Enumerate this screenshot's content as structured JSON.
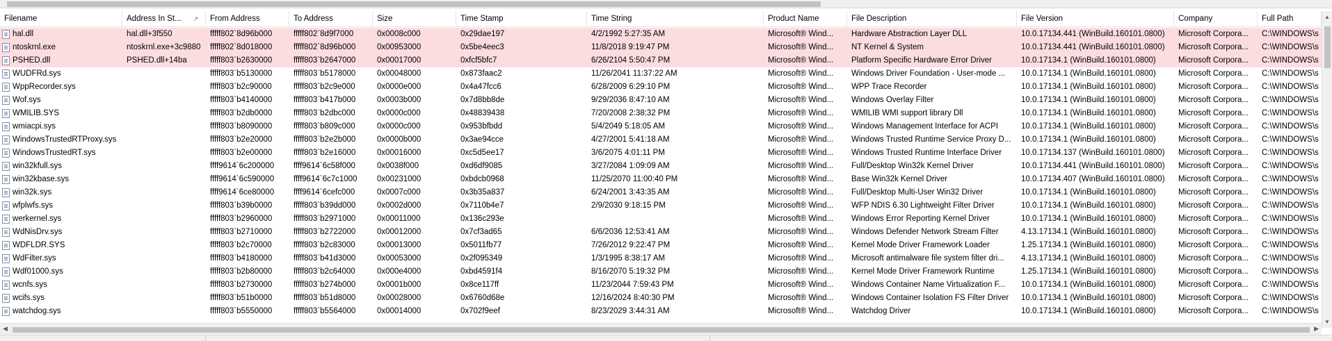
{
  "columns": [
    {
      "key": "filename",
      "label": "Filename"
    },
    {
      "key": "address_in_stack",
      "label": "Address In St..."
    },
    {
      "key": "from_address",
      "label": "From Address"
    },
    {
      "key": "to_address",
      "label": "To Address"
    },
    {
      "key": "size",
      "label": "Size"
    },
    {
      "key": "time_stamp",
      "label": "Time Stamp"
    },
    {
      "key": "time_string",
      "label": "Time String"
    },
    {
      "key": "product_name",
      "label": "Product Name"
    },
    {
      "key": "file_description",
      "label": "File Description"
    },
    {
      "key": "file_version",
      "label": "File Version"
    },
    {
      "key": "company",
      "label": "Company"
    },
    {
      "key": "full_path",
      "label": "Full Path"
    }
  ],
  "sort_indicator": "↗",
  "highlight_color": "#fbdde0",
  "rows": [
    {
      "highlight": true,
      "filename": "hal.dll",
      "address_in_stack": "hal.dll+3f550",
      "from_address": "fffff802`8d96b000",
      "to_address": "fffff802`8d9f7000",
      "size": "0x0008c000",
      "time_stamp": "0x29dae197",
      "time_string": "4/2/1992 5:27:35 AM",
      "product_name": "Microsoft® Wind...",
      "file_description": "Hardware Abstraction Layer DLL",
      "file_version": "10.0.17134.441 (WinBuild.160101.0800)",
      "company": "Microsoft Corpora...",
      "full_path": "C:\\WINDOWS\\s"
    },
    {
      "highlight": true,
      "filename": "ntoskrnl.exe",
      "address_in_stack": "ntoskrnl.exe+3c9880",
      "from_address": "fffff802`8d018000",
      "to_address": "fffff802`8d96b000",
      "size": "0x00953000",
      "time_stamp": "0x5be4eec3",
      "time_string": "11/8/2018 9:19:47 PM",
      "product_name": "Microsoft® Wind...",
      "file_description": "NT Kernel & System",
      "file_version": "10.0.17134.441 (WinBuild.160101.0800)",
      "company": "Microsoft Corpora...",
      "full_path": "C:\\WINDOWS\\s"
    },
    {
      "highlight": true,
      "filename": "PSHED.dll",
      "address_in_stack": "PSHED.dll+14ba",
      "from_address": "fffff803`b2630000",
      "to_address": "fffff803`b2647000",
      "size": "0x00017000",
      "time_stamp": "0xfcf5bfc7",
      "time_string": "6/26/2104 5:50:47 PM",
      "product_name": "Microsoft® Wind...",
      "file_description": "Platform Specific Hardware Error Driver",
      "file_version": "10.0.17134.1 (WinBuild.160101.0800)",
      "company": "Microsoft Corpora...",
      "full_path": "C:\\WINDOWS\\s"
    },
    {
      "highlight": false,
      "filename": "WUDFRd.sys",
      "address_in_stack": "",
      "from_address": "fffff803`b5130000",
      "to_address": "fffff803`b5178000",
      "size": "0x00048000",
      "time_stamp": "0x873faac2",
      "time_string": "11/26/2041 11:37:22 AM",
      "product_name": "Microsoft® Wind...",
      "file_description": "Windows Driver Foundation - User-mode ...",
      "file_version": "10.0.17134.1 (WinBuild.160101.0800)",
      "company": "Microsoft Corpora...",
      "full_path": "C:\\WINDOWS\\s"
    },
    {
      "highlight": false,
      "filename": "WppRecorder.sys",
      "address_in_stack": "",
      "from_address": "fffff803`b2c90000",
      "to_address": "fffff803`b2c9e000",
      "size": "0x0000e000",
      "time_stamp": "0x4a47fcc6",
      "time_string": "6/28/2009 6:29:10 PM",
      "product_name": "Microsoft® Wind...",
      "file_description": "WPP Trace Recorder",
      "file_version": "10.0.17134.1 (WinBuild.160101.0800)",
      "company": "Microsoft Corpora...",
      "full_path": "C:\\WINDOWS\\s"
    },
    {
      "highlight": false,
      "filename": "Wof.sys",
      "address_in_stack": "",
      "from_address": "fffff803`b4140000",
      "to_address": "fffff803`b417b000",
      "size": "0x0003b000",
      "time_stamp": "0x7d8bb8de",
      "time_string": "9/29/2036 8:47:10 AM",
      "product_name": "Microsoft® Wind...",
      "file_description": "Windows Overlay Filter",
      "file_version": "10.0.17134.1 (WinBuild.160101.0800)",
      "company": "Microsoft Corpora...",
      "full_path": "C:\\WINDOWS\\s"
    },
    {
      "highlight": false,
      "filename": "WMILIB.SYS",
      "address_in_stack": "",
      "from_address": "fffff803`b2db0000",
      "to_address": "fffff803`b2dbc000",
      "size": "0x0000c000",
      "time_stamp": "0x48839438",
      "time_string": "7/20/2008 2:38:32 PM",
      "product_name": "Microsoft® Wind...",
      "file_description": "WMILIB WMI support library Dll",
      "file_version": "10.0.17134.1 (WinBuild.160101.0800)",
      "company": "Microsoft Corpora...",
      "full_path": "C:\\WINDOWS\\s"
    },
    {
      "highlight": false,
      "filename": "wmiacpi.sys",
      "address_in_stack": "",
      "from_address": "fffff803`b8090000",
      "to_address": "fffff803`b809c000",
      "size": "0x0000c000",
      "time_stamp": "0x953bfbdd",
      "time_string": "5/4/2049 5:18:05 AM",
      "product_name": "Microsoft® Wind...",
      "file_description": "Windows Management Interface for ACPI",
      "file_version": "10.0.17134.1 (WinBuild.160101.0800)",
      "company": "Microsoft Corpora...",
      "full_path": "C:\\WINDOWS\\s"
    },
    {
      "highlight": false,
      "filename": "WindowsTrustedRTProxy.sys",
      "address_in_stack": "",
      "from_address": "fffff803`b2e20000",
      "to_address": "fffff803`b2e2b000",
      "size": "0x0000b000",
      "time_stamp": "0x3ae94cce",
      "time_string": "4/27/2001 5:41:18 AM",
      "product_name": "Microsoft® Wind...",
      "file_description": "Windows Trusted Runtime Service Proxy D...",
      "file_version": "10.0.17134.1 (WinBuild.160101.0800)",
      "company": "Microsoft Corpora...",
      "full_path": "C:\\WINDOWS\\s"
    },
    {
      "highlight": false,
      "filename": "WindowsTrustedRT.sys",
      "address_in_stack": "",
      "from_address": "fffff803`b2e00000",
      "to_address": "fffff803`b2e16000",
      "size": "0x00016000",
      "time_stamp": "0xc5d5ee17",
      "time_string": "3/6/2075 4:01:11 PM",
      "product_name": "Microsoft® Wind...",
      "file_description": "Windows Trusted Runtime Interface Driver",
      "file_version": "10.0.17134.137 (WinBuild.160101.0800)",
      "company": "Microsoft Corpora...",
      "full_path": "C:\\WINDOWS\\s"
    },
    {
      "highlight": false,
      "filename": "win32kfull.sys",
      "address_in_stack": "",
      "from_address": "ffff9614`6c200000",
      "to_address": "ffff9614`6c58f000",
      "size": "0x0038f000",
      "time_stamp": "0xd6df9085",
      "time_string": "3/27/2084 1:09:09 AM",
      "product_name": "Microsoft® Wind...",
      "file_description": "Full/Desktop Win32k Kernel Driver",
      "file_version": "10.0.17134.441 (WinBuild.160101.0800)",
      "company": "Microsoft Corpora...",
      "full_path": "C:\\WINDOWS\\s"
    },
    {
      "highlight": false,
      "filename": "win32kbase.sys",
      "address_in_stack": "",
      "from_address": "ffff9614`6c590000",
      "to_address": "ffff9614`6c7c1000",
      "size": "0x00231000",
      "time_stamp": "0xbdcb0968",
      "time_string": "11/25/2070 11:00:40 PM",
      "product_name": "Microsoft® Wind...",
      "file_description": "Base Win32k Kernel Driver",
      "file_version": "10.0.17134.407 (WinBuild.160101.0800)",
      "company": "Microsoft Corpora...",
      "full_path": "C:\\WINDOWS\\s"
    },
    {
      "highlight": false,
      "filename": "win32k.sys",
      "address_in_stack": "",
      "from_address": "ffff9614`6ce80000",
      "to_address": "ffff9614`6cefc000",
      "size": "0x0007c000",
      "time_stamp": "0x3b35a837",
      "time_string": "6/24/2001 3:43:35 AM",
      "product_name": "Microsoft® Wind...",
      "file_description": "Full/Desktop Multi-User Win32 Driver",
      "file_version": "10.0.17134.1 (WinBuild.160101.0800)",
      "company": "Microsoft Corpora...",
      "full_path": "C:\\WINDOWS\\s"
    },
    {
      "highlight": false,
      "filename": "wfplwfs.sys",
      "address_in_stack": "",
      "from_address": "fffff803`b39b0000",
      "to_address": "fffff803`b39dd000",
      "size": "0x0002d000",
      "time_stamp": "0x7110b4e7",
      "time_string": "2/9/2030 9:18:15 PM",
      "product_name": "Microsoft® Wind...",
      "file_description": "WFP NDIS 6.30 Lightweight Filter Driver",
      "file_version": "10.0.17134.1 (WinBuild.160101.0800)",
      "company": "Microsoft Corpora...",
      "full_path": "C:\\WINDOWS\\s"
    },
    {
      "highlight": false,
      "filename": "werkernel.sys",
      "address_in_stack": "",
      "from_address": "fffff803`b2960000",
      "to_address": "fffff803`b2971000",
      "size": "0x00011000",
      "time_stamp": "0x136c293e",
      "time_string": "",
      "product_name": "Microsoft® Wind...",
      "file_description": "Windows Error Reporting Kernel Driver",
      "file_version": "10.0.17134.1 (WinBuild.160101.0800)",
      "company": "Microsoft Corpora...",
      "full_path": "C:\\WINDOWS\\s"
    },
    {
      "highlight": false,
      "filename": "WdNisDrv.sys",
      "address_in_stack": "",
      "from_address": "fffff803`b2710000",
      "to_address": "fffff803`b2722000",
      "size": "0x00012000",
      "time_stamp": "0x7cf3ad65",
      "time_string": "6/6/2036 12:53:41 AM",
      "product_name": "Microsoft® Wind...",
      "file_description": "Windows Defender Network Stream Filter",
      "file_version": "4.13.17134.1 (WinBuild.160101.0800)",
      "company": "Microsoft Corpora...",
      "full_path": "C:\\WINDOWS\\s"
    },
    {
      "highlight": false,
      "filename": "WDFLDR.SYS",
      "address_in_stack": "",
      "from_address": "fffff803`b2c70000",
      "to_address": "fffff803`b2c83000",
      "size": "0x00013000",
      "time_stamp": "0x5011fb77",
      "time_string": "7/26/2012 9:22:47 PM",
      "product_name": "Microsoft® Wind...",
      "file_description": "Kernel Mode Driver Framework Loader",
      "file_version": "1.25.17134.1 (WinBuild.160101.0800)",
      "company": "Microsoft Corpora...",
      "full_path": "C:\\WINDOWS\\s"
    },
    {
      "highlight": false,
      "filename": "WdFilter.sys",
      "address_in_stack": "",
      "from_address": "fffff803`b4180000",
      "to_address": "fffff803`b41d3000",
      "size": "0x00053000",
      "time_stamp": "0x2f095349",
      "time_string": "1/3/1995 8:38:17 AM",
      "product_name": "Microsoft® Wind...",
      "file_description": "Microsoft antimalware file system filter dri...",
      "file_version": "4.13.17134.1 (WinBuild.160101.0800)",
      "company": "Microsoft Corpora...",
      "full_path": "C:\\WINDOWS\\s"
    },
    {
      "highlight": false,
      "filename": "Wdf01000.sys",
      "address_in_stack": "",
      "from_address": "fffff803`b2b80000",
      "to_address": "fffff803`b2c64000",
      "size": "0x000e4000",
      "time_stamp": "0xbd4591f4",
      "time_string": "8/16/2070 5:19:32 PM",
      "product_name": "Microsoft® Wind...",
      "file_description": "Kernel Mode Driver Framework Runtime",
      "file_version": "1.25.17134.1 (WinBuild.160101.0800)",
      "company": "Microsoft Corpora...",
      "full_path": "C:\\WINDOWS\\s"
    },
    {
      "highlight": false,
      "filename": "wcnfs.sys",
      "address_in_stack": "",
      "from_address": "fffff803`b2730000",
      "to_address": "fffff803`b274b000",
      "size": "0x0001b000",
      "time_stamp": "0x8ce117ff",
      "time_string": "11/23/2044 7:59:43 PM",
      "product_name": "Microsoft® Wind...",
      "file_description": "Windows Container Name Virtualization F...",
      "file_version": "10.0.17134.1 (WinBuild.160101.0800)",
      "company": "Microsoft Corpora...",
      "full_path": "C:\\WINDOWS\\s"
    },
    {
      "highlight": false,
      "filename": "wcifs.sys",
      "address_in_stack": "",
      "from_address": "fffff803`b51b0000",
      "to_address": "fffff803`b51d8000",
      "size": "0x00028000",
      "time_stamp": "0x6760d68e",
      "time_string": "12/16/2024 8:40:30 PM",
      "product_name": "Microsoft® Wind...",
      "file_description": "Windows Container Isolation FS Filter Driver",
      "file_version": "10.0.17134.1 (WinBuild.160101.0800)",
      "company": "Microsoft Corpora...",
      "full_path": "C:\\WINDOWS\\s"
    },
    {
      "highlight": false,
      "filename": "watchdog.sys",
      "address_in_stack": "",
      "from_address": "fffff803`b5550000",
      "to_address": "fffff803`b5564000",
      "size": "0x00014000",
      "time_stamp": "0x702f9eef",
      "time_string": "8/23/2029 3:44:31 AM",
      "product_name": "Microsoft® Wind...",
      "file_description": "Watchdog Driver",
      "file_version": "10.0.17134.1 (WinBuild.160101.0800)",
      "company": "Microsoft Corpora...",
      "full_path": "C:\\WINDOWS\\s"
    }
  ]
}
